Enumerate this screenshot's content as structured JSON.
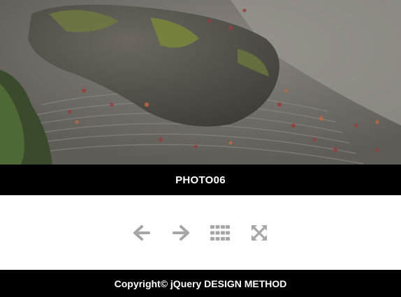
{
  "gallery": {
    "current_photo_caption": "PHOTO06"
  },
  "controls": {
    "icons": [
      "arrow-left-icon",
      "arrow-right-icon",
      "grid-icon",
      "fullscreen-icon"
    ],
    "icon_color": "#a6a6a6"
  },
  "footer": {
    "copyright": "Copyright© jQuery DESIGN METHOD"
  },
  "colors": {
    "bar_background": "#000000",
    "text": "#ffffff"
  }
}
